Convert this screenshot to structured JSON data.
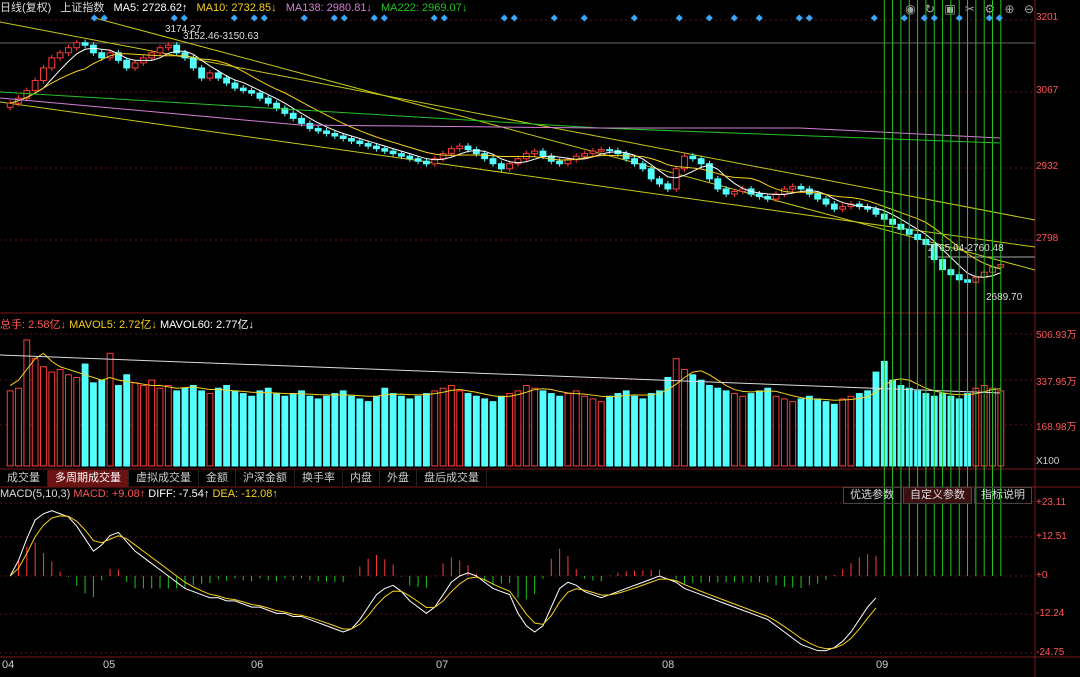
{
  "header": {
    "period": "日线(复权)",
    "symbol": "上证指数",
    "ma5": "MA5: 2728.62↑",
    "ma10": "MA10: 2732.85↓",
    "ma138": "MA138: 2980.81↓",
    "ma222": "MA222: 2969.07↓",
    "colors": {
      "ma5": "#ffffff",
      "ma10": "#f7d11e",
      "ma138": "#d67ed6",
      "ma222": "#22c322"
    }
  },
  "controls": [
    "eye-icon",
    "refresh-icon",
    "lock-icon",
    "scissors-icon",
    "settings-icon",
    "zoom-in-icon",
    "zoom-out-icon"
  ],
  "price_axis": [
    "3201",
    "3067",
    "2932",
    "2798"
  ],
  "annotations": {
    "high": "3174.27",
    "range1": "3152.46-3150.63",
    "range2": "2765.64-2760.48",
    "low": "2689.70"
  },
  "volume": {
    "total": "总手: 2.58亿↓",
    "mavol5": "MAVOL5: 2.72亿↓",
    "mavol60": "MAVOL60: 2.77亿↓",
    "axis": [
      "506.93万",
      "337.95万",
      "168.98万",
      "X100"
    ]
  },
  "tabs": [
    "成交量",
    "多周期成交量",
    "虚拟成交量",
    "金额",
    "沪深金额",
    "换手率",
    "内盘",
    "外盘",
    "盘后成交量"
  ],
  "active_tab": 1,
  "macd": {
    "title": "MACD(5,10,3)",
    "macd": "MACD: +9.08↑",
    "diff": "DIFF: -7.54↑",
    "dea": "DEA: -12.08↑",
    "buttons": [
      "优选参数",
      "自定义参数",
      "指标说明"
    ],
    "axis": [
      "+23.11",
      "+12.51",
      "+0",
      "-12.24",
      "-24.75"
    ]
  },
  "dates": [
    "04",
    "05",
    "06",
    "07",
    "08",
    "09"
  ],
  "chart_data": {
    "type": "candlestick",
    "ylim": [
      2640,
      3215
    ],
    "closes": [
      3050,
      3060,
      3075,
      3095,
      3120,
      3140,
      3150,
      3160,
      3170,
      3165,
      3150,
      3140,
      3150,
      3135,
      3120,
      3130,
      3140,
      3150,
      3160,
      3165,
      3150,
      3140,
      3120,
      3100,
      3110,
      3100,
      3090,
      3080,
      3075,
      3070,
      3060,
      3050,
      3040,
      3030,
      3020,
      3010,
      3000,
      2995,
      2990,
      2985,
      2980,
      2975,
      2970,
      2965,
      2960,
      2955,
      2950,
      2945,
      2940,
      2935,
      2930,
      2940,
      2950,
      2960,
      2965,
      2958,
      2950,
      2940,
      2930,
      2920,
      2930,
      2940,
      2950,
      2955,
      2945,
      2935,
      2930,
      2938,
      2945,
      2950,
      2955,
      2958,
      2956,
      2950,
      2940,
      2930,
      2920,
      2900,
      2890,
      2880,
      2920,
      2945,
      2940,
      2930,
      2900,
      2880,
      2870,
      2875,
      2880,
      2870,
      2865,
      2860,
      2870,
      2880,
      2885,
      2880,
      2870,
      2860,
      2850,
      2840,
      2845,
      2850,
      2845,
      2840,
      2830,
      2820,
      2810,
      2800,
      2790,
      2780,
      2770,
      2740,
      2720,
      2710,
      2700,
      2695,
      2705,
      2715,
      2725,
      2730
    ],
    "volumes": [
      280,
      290,
      470,
      400,
      370,
      350,
      360,
      340,
      330,
      380,
      310,
      320,
      420,
      300,
      340,
      310,
      300,
      320,
      290,
      300,
      280,
      290,
      300,
      280,
      270,
      290,
      300,
      280,
      270,
      260,
      280,
      290,
      270,
      260,
      270,
      280,
      260,
      250,
      260,
      270,
      280,
      260,
      250,
      240,
      260,
      290,
      270,
      260,
      250,
      260,
      270,
      280,
      290,
      300,
      280,
      270,
      260,
      250,
      240,
      260,
      270,
      280,
      300,
      290,
      280,
      270,
      260,
      270,
      280,
      260,
      250,
      240,
      260,
      270,
      280,
      260,
      250,
      270,
      280,
      330,
      400,
      360,
      340,
      320,
      300,
      290,
      280,
      270,
      260,
      270,
      280,
      290,
      260,
      250,
      240,
      250,
      260,
      250,
      240,
      230,
      250,
      260,
      270,
      280,
      350,
      390,
      320,
      300,
      290,
      280,
      270,
      260,
      270,
      260,
      250,
      270,
      290,
      300,
      290,
      280
    ],
    "mavol5": [
      300,
      320,
      360,
      400,
      420,
      390,
      370,
      360,
      350,
      340,
      330,
      320,
      330,
      320,
      315,
      310,
      305,
      300,
      300,
      295,
      290,
      292,
      295,
      290,
      285,
      285,
      283,
      280,
      278,
      275,
      274,
      273,
      272,
      270,
      270,
      269,
      268,
      266,
      265,
      264,
      265,
      264,
      262,
      260,
      260,
      265,
      267,
      268,
      266,
      265,
      266,
      270,
      275,
      282,
      285,
      280,
      275,
      268,
      262,
      258,
      260,
      266,
      275,
      285,
      288,
      285,
      278,
      272,
      270,
      268,
      264,
      260,
      258,
      260,
      263,
      265,
      264,
      265,
      270,
      285,
      305,
      330,
      350,
      355,
      340,
      320,
      300,
      285,
      278,
      276,
      278,
      280,
      278,
      270,
      262,
      255,
      250,
      250,
      248,
      245,
      246,
      248,
      252,
      258,
      275,
      300,
      320,
      325,
      320,
      305,
      290,
      280,
      273,
      268,
      266,
      265,
      270,
      277,
      285,
      288
    ],
    "macd_diff": [
      0,
      5,
      12,
      18,
      20,
      21,
      20,
      19,
      16,
      12,
      8,
      10,
      13,
      14,
      11,
      8,
      6,
      4,
      2,
      0,
      -2,
      -4,
      -5,
      -6,
      -7,
      -7,
      -8,
      -8,
      -9,
      -10,
      -10,
      -11,
      -12,
      -12,
      -13,
      -13,
      -14,
      -15,
      -16,
      -17,
      -18,
      -17,
      -14,
      -10,
      -6,
      -4,
      -3,
      -5,
      -8,
      -10,
      -12,
      -10,
      -6,
      -2,
      0,
      1,
      0,
      -2,
      -4,
      -5,
      -6,
      -12,
      -16,
      -18,
      -16,
      -10,
      -4,
      -2,
      -3,
      -5,
      -6,
      -7,
      -6,
      -5,
      -4,
      -3,
      -2,
      -1,
      0,
      -1,
      -2,
      -4,
      -5,
      -6,
      -7,
      -8,
      -9,
      -10,
      -11,
      -12,
      -13,
      -14,
      -16,
      -18,
      -20,
      -22,
      -23,
      -24,
      -24,
      -23,
      -21,
      -18,
      -14,
      -10,
      -7
    ]
  }
}
